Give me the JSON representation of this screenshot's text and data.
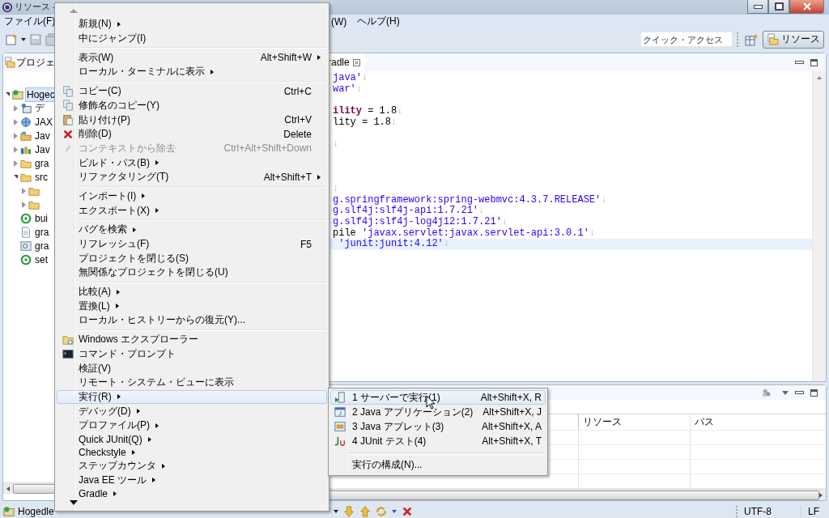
{
  "window": {
    "title": "リソース -"
  },
  "menubar": [
    {
      "label": "ファイル(F)"
    },
    {
      "label": "(W)"
    },
    {
      "label": "ヘルプ(H)"
    }
  ],
  "quick_access": {
    "placeholder": "クイック・アクセス"
  },
  "perspective": {
    "label": "リソース",
    "selected": true
  },
  "project_explorer": {
    "tab": "プロジェ",
    "tree": [
      {
        "label": "Hogec",
        "kind": "project",
        "expanded": true,
        "selected": true,
        "children": [
          {
            "label": "デ",
            "kind": "deploy",
            "expanded": false,
            "selected": false
          },
          {
            "label": "JAX",
            "kind": "webservice",
            "expanded": false,
            "selected": false
          },
          {
            "label": "Jav",
            "kind": "resources",
            "expanded": false,
            "selected": false
          },
          {
            "label": "Jav",
            "kind": "library",
            "expanded": false,
            "selected": false
          },
          {
            "label": "gra",
            "kind": "folder",
            "expanded": false,
            "selected": false
          },
          {
            "label": "src",
            "kind": "folder",
            "expanded": true,
            "selected": false,
            "children": [
              {
                "kind": "folder",
                "expanded": false
              },
              {
                "kind": "folder",
                "expanded": false
              }
            ]
          },
          {
            "label": "bui",
            "kind": "gradle",
            "selected": false
          },
          {
            "label": "gra",
            "kind": "file",
            "selected": false
          },
          {
            "label": "gra",
            "kind": "settings",
            "selected": false
          },
          {
            "label": "set",
            "kind": "gradle",
            "selected": false
          }
        ]
      }
    ]
  },
  "editor": {
    "tab": "radle",
    "lines": [
      {
        "current": false,
        "segments": [
          {
            "text": "java'",
            "kind": "string"
          },
          {
            "text": "↓",
            "kind": "whitespace"
          }
        ]
      },
      {
        "current": false,
        "segments": [
          {
            "text": "war'",
            "kind": "string"
          },
          {
            "text": "↓",
            "kind": "whitespace"
          }
        ]
      },
      {
        "current": false
      },
      {
        "current": false,
        "segments": [
          {
            "text": "ility",
            "kind": "keyword"
          },
          {
            "text": " = 1.8",
            "kind": "plain"
          },
          {
            "text": "↓",
            "kind": "whitespace"
          }
        ]
      },
      {
        "current": false,
        "segments": [
          {
            "text": "lity = 1.8",
            "kind": "plain"
          },
          {
            "text": "↓",
            "kind": "whitespace"
          }
        ]
      },
      {
        "current": false
      },
      {
        "current": false,
        "segments": [
          {
            "text": "↓",
            "kind": "whitespace"
          }
        ]
      },
      {
        "current": false
      },
      {
        "current": false
      },
      {
        "current": false
      },
      {
        "current": false,
        "segments": [
          {
            "text": "↓",
            "kind": "whitespace"
          }
        ]
      },
      {
        "current": false,
        "segments": [
          {
            "text": "g.springframework:spring-webmvc:4.3.7.RELEASE'",
            "kind": "string"
          },
          {
            "text": "↓",
            "kind": "whitespace"
          }
        ]
      },
      {
        "current": false,
        "segments": [
          {
            "text": "g.slf4j:slf4j-api:1.7.21'",
            "kind": "string"
          },
          {
            "text": "↓",
            "kind": "whitespace"
          }
        ]
      },
      {
        "current": false,
        "segments": [
          {
            "text": "g.slf4j:slf4j-log4j12:1.7.21'",
            "kind": "string"
          },
          {
            "text": "↓",
            "kind": "whitespace"
          }
        ]
      },
      {
        "current": false,
        "segments": [
          {
            "text": "pile ",
            "kind": "plain"
          },
          {
            "text": "'javax.servlet:javax.servlet-api:3.0.1'",
            "kind": "string"
          },
          {
            "text": "↓",
            "kind": "whitespace"
          }
        ]
      },
      {
        "current": true,
        "segments": [
          {
            "text": " 'junit:junit:4.12'",
            "kind": "string"
          },
          {
            "text": "↓",
            "kind": "whitespace"
          }
        ]
      }
    ]
  },
  "bottom_panel": {
    "columns": [
      {
        "label": "リソース"
      },
      {
        "label": "パス"
      }
    ]
  },
  "status_bar": {
    "project": "Hogedle",
    "encoding": "UTF-8",
    "line_delimiter": "LF"
  },
  "context_menu": {
    "groups": [
      {
        "items": [
          {
            "label": "新規(N)",
            "kind": "plain",
            "submenu": true,
            "disabled": false,
            "selected": false
          },
          {
            "label": "中にジャンプ(I)",
            "kind": "plain",
            "submenu": false,
            "disabled": false,
            "selected": false
          }
        ]
      },
      {
        "items": [
          {
            "label": "表示(W)",
            "shortcut": "Alt+Shift+W",
            "kind": "plain",
            "submenu": true,
            "disabled": false,
            "selected": false
          },
          {
            "label": "ローカル・ターミナルに表示",
            "kind": "plain",
            "submenu": true,
            "disabled": false,
            "selected": false
          }
        ]
      },
      {
        "items": [
          {
            "label": "コピー(C)",
            "shortcut": "Ctrl+C",
            "kind": "copy",
            "submenu": false,
            "disabled": false,
            "selected": false
          },
          {
            "label": "修飾名のコピー(Y)",
            "kind": "copy",
            "submenu": false,
            "disabled": false,
            "selected": false
          },
          {
            "label": "貼り付け(P)",
            "shortcut": "Ctrl+V",
            "kind": "paste",
            "submenu": false,
            "disabled": false,
            "selected": false
          },
          {
            "label": "削除(D)",
            "shortcut": "Delete",
            "kind": "delete",
            "submenu": false,
            "disabled": false,
            "selected": false
          },
          {
            "label": "コンテキストから除去",
            "shortcut": "Ctrl+Alt+Shift+Down",
            "kind": "remove",
            "submenu": false,
            "disabled": true,
            "selected": false
          },
          {
            "label": "ビルド・パス(B)",
            "kind": "plain",
            "submenu": true,
            "disabled": false,
            "selected": false
          },
          {
            "label": "リファクタリング(T)",
            "shortcut": "Alt+Shift+T",
            "kind": "plain",
            "submenu": true,
            "disabled": false,
            "selected": false
          }
        ]
      },
      {
        "items": [
          {
            "label": "インポート(I)",
            "kind": "plain",
            "submenu": true,
            "disabled": false,
            "selected": false
          },
          {
            "label": "エクスポート(X)",
            "kind": "plain",
            "submenu": true,
            "disabled": false,
            "selected": false
          }
        ]
      },
      {
        "items": [
          {
            "label": "バグを検索",
            "kind": "plain",
            "submenu": true,
            "disabled": false,
            "selected": false
          },
          {
            "label": "リフレッシュ(F)",
            "shortcut": "F5",
            "kind": "plain",
            "submenu": false,
            "disabled": false,
            "selected": false
          },
          {
            "label": "プロジェクトを閉じる(S)",
            "kind": "plain",
            "submenu": false,
            "disabled": false,
            "selected": false
          },
          {
            "label": "無関係なプロジェクトを閉じる(U)",
            "kind": "plain",
            "submenu": false,
            "disabled": false,
            "selected": false
          }
        ]
      },
      {
        "items": [
          {
            "label": "比較(A)",
            "kind": "plain",
            "submenu": true,
            "disabled": false,
            "selected": false
          },
          {
            "label": "置換(L)",
            "kind": "plain",
            "submenu": true,
            "disabled": false,
            "selected": false
          },
          {
            "label": "ローカル・ヒストリーからの復元(Y)...",
            "kind": "plain",
            "submenu": false,
            "disabled": false,
            "selected": false
          }
        ]
      },
      {
        "items": [
          {
            "label": "Windows エクスプローラー",
            "kind": "explorer",
            "submenu": false,
            "disabled": false,
            "selected": false
          },
          {
            "label": "コマンド・プロンプト",
            "kind": "terminal",
            "submenu": false,
            "disabled": false,
            "selected": false
          },
          {
            "label": "検証(V)",
            "kind": "plain",
            "submenu": false,
            "disabled": false,
            "selected": false
          },
          {
            "label": "リモート・システム・ビューに表示",
            "kind": "plain",
            "submenu": false,
            "disabled": false,
            "selected": false
          },
          {
            "label": "実行(R)",
            "kind": "plain",
            "submenu": true,
            "disabled": false,
            "selected": true
          },
          {
            "label": "デバッグ(D)",
            "kind": "plain",
            "submenu": true,
            "disabled": false,
            "selected": false
          },
          {
            "label": "プロファイル(P)",
            "kind": "plain",
            "submenu": true,
            "disabled": false,
            "selected": false
          },
          {
            "label": "Quick JUnit(Q)",
            "kind": "plain",
            "submenu": true,
            "disabled": false,
            "selected": false
          },
          {
            "label": "Checkstyle",
            "kind": "plain",
            "submenu": true,
            "disabled": false,
            "selected": false
          },
          {
            "label": "ステップカウンタ",
            "kind": "plain",
            "submenu": true,
            "disabled": false,
            "selected": false
          },
          {
            "label": "Java EE ツール",
            "kind": "plain",
            "submenu": true,
            "disabled": false,
            "selected": false
          },
          {
            "label": "Gradle",
            "kind": "plain",
            "submenu": true,
            "disabled": false,
            "selected": false
          }
        ]
      }
    ]
  },
  "run_submenu": {
    "groups": [
      {
        "items": [
          {
            "label": "1 サーバーで実行(1)",
            "shortcut": "Alt+Shift+X, R",
            "kind": "server",
            "selected": true
          },
          {
            "label": "2 Java アプリケーション(2)",
            "shortcut": "Alt+Shift+X, J",
            "kind": "application",
            "selected": false
          },
          {
            "label": "3 Java アプレット(3)",
            "shortcut": "Alt+Shift+X, A",
            "kind": "applet",
            "selected": false
          },
          {
            "label": "4 JUnit テスト(4)",
            "shortcut": "Alt+Shift+X, T",
            "kind": "junit",
            "selected": false
          }
        ]
      },
      {
        "items": [
          {
            "label": "実行の構成(N)...",
            "kind": "plain",
            "selected": false
          }
        ]
      }
    ]
  }
}
